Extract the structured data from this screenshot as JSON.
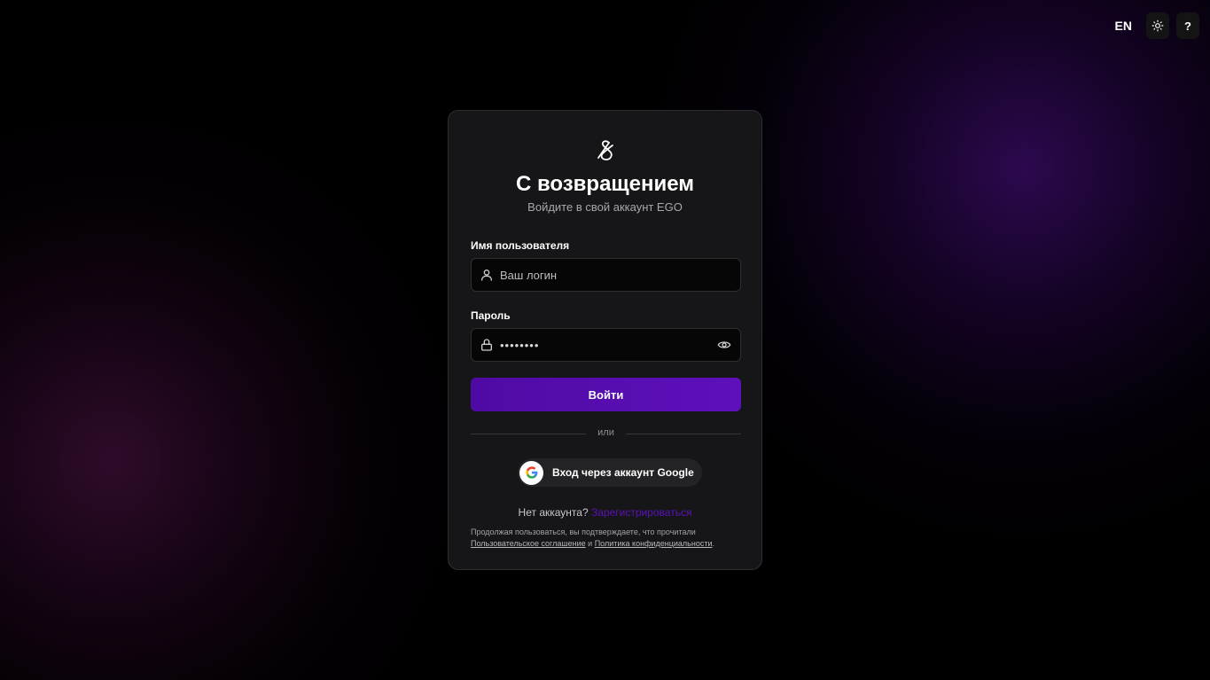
{
  "topbar": {
    "lang_label": "EN",
    "theme_icon": "sun-icon",
    "help_label": "?"
  },
  "login": {
    "logo_icon": "ego-ampersand-logo",
    "title": "С возвращением",
    "subtitle": "Войдите в свой аккаунт EGO",
    "username": {
      "label": "Имя пользователя",
      "placeholder": "Ваш логин",
      "value": "",
      "icon": "user-icon"
    },
    "password": {
      "label": "Пароль",
      "value": "••••••••",
      "icon": "lock-icon",
      "toggle_icon": "eye-icon"
    },
    "submit_label": "Войти",
    "divider_text": "или",
    "google_label": "Вход через аккаунт Google",
    "signup_prompt": "Нет аккаунта?",
    "signup_link": "Зарегистрироваться",
    "legal": {
      "prefix": "Продолжая пользоваться, вы подтверждаете, что прочитали",
      "terms_link": "Пользовательское соглашение",
      "conjunction": "и",
      "privacy_link": "Политика конфиденциальности",
      "suffix": "."
    }
  },
  "colors": {
    "accent": "#5b12b8",
    "card_bg": "#161618",
    "page_bg": "#000000"
  }
}
